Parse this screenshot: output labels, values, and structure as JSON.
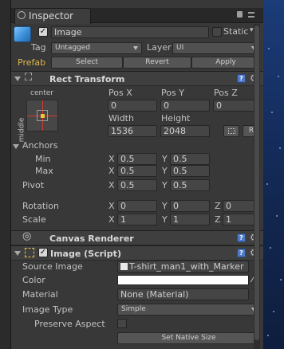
{
  "window": {
    "tab_title": "Inspector"
  },
  "game_object": {
    "name": "Image",
    "active": true,
    "static_label": "Static",
    "static": false,
    "tag_label": "Tag",
    "tag_value": "Untagged",
    "layer_label": "Layer",
    "layer_value": "UI",
    "prefab_label": "Prefab",
    "prefab_buttons": [
      "Select",
      "Revert",
      "Apply"
    ]
  },
  "rect_transform": {
    "title": "Rect Transform",
    "anchor_preset_h": "center",
    "anchor_preset_v": "middle",
    "col_labels": [
      "Pos X",
      "Pos Y",
      "Pos Z"
    ],
    "pos": [
      "0",
      "0",
      "0"
    ],
    "width_label": "Width",
    "height_label": "Height",
    "width": "1536",
    "height": "2048",
    "raw_button": "R",
    "anchors_label": "Anchors",
    "min_label": "Min",
    "min_x": "0.5",
    "min_y": "0.5",
    "max_label": "Max",
    "max_x": "0.5",
    "max_y": "0.5",
    "pivot_label": "Pivot",
    "pivot_x": "0.5",
    "pivot_y": "0.5",
    "rotation_label": "Rotation",
    "rot": [
      "0",
      "0",
      "0"
    ],
    "scale_label": "Scale",
    "scale": [
      "1",
      "1",
      "1"
    ],
    "axis_x": "X",
    "axis_y": "Y",
    "axis_z": "Z"
  },
  "canvas_renderer": {
    "title": "Canvas Renderer"
  },
  "image_script": {
    "title": "Image (Script)",
    "enabled": true,
    "source_image_label": "Source Image",
    "source_image_value": "T-shirt_man1_with_Marker",
    "color_label": "Color",
    "color_value": "#ffffff",
    "material_label": "Material",
    "material_value": "None (Material)",
    "image_type_label": "Image Type",
    "image_type_value": "Simple",
    "preserve_aspect_label": "Preserve Aspect",
    "preserve_aspect": false,
    "native_size_button": "Set Native Size"
  },
  "theme": {
    "accent": "#4e79c9",
    "prefab_color": "#e0b64a",
    "anchor_red": "#d53a2a",
    "anchor_yellow": "#e8c83a"
  }
}
